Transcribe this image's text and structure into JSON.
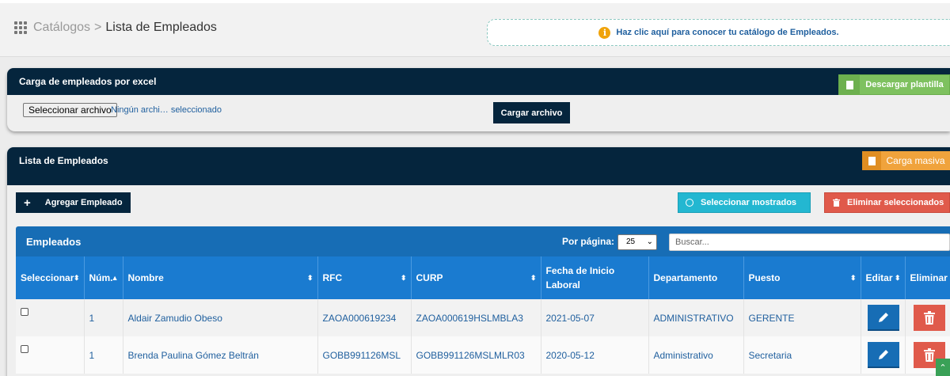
{
  "breadcrumb": {
    "parent": "Catálogos",
    "separator": ">",
    "current": "Lista de Empleados"
  },
  "info_banner": {
    "icon": "info-icon",
    "text": "Haz clic aquí para conocer tu catálogo de Empleados."
  },
  "excel_card": {
    "title": "Carga de empleados por excel",
    "download_label": "Descargar plantilla",
    "file_button": "Seleccionar archivo",
    "file_status": "Ningún archi… seleccionado",
    "upload_label": "Cargar archivo"
  },
  "list_card": {
    "title": "Lista de Empleados",
    "bulk_label": "Carga masiva",
    "add_label": "Agregar Empleado",
    "add_icon": "+",
    "select_shown_label": "Seleccionar mostrados",
    "delete_selected_label": "Eliminar seleccionados"
  },
  "table": {
    "title": "Empleados",
    "per_page_label": "Por página:",
    "per_page_value": "25",
    "search_placeholder": "Buscar...",
    "columns": [
      "Seleccionar",
      "Núm.",
      "Nombre",
      "RFC",
      "CURP",
      "Fecha de Inicio Laboral",
      "Departamento",
      "Puesto",
      "Editar",
      "Eliminar"
    ],
    "rows": [
      {
        "num": "1",
        "nombre": "Aldair Zamudio Obeso",
        "rfc": "ZAOA000619234",
        "curp": "ZAOA000619HSLMBLA3",
        "fecha": "2021-05-07",
        "departamento": "ADMINISTRATIVO",
        "puesto": "GERENTE"
      },
      {
        "num": "1",
        "nombre": "Brenda Paulina Gómez Beltrán",
        "rfc": "GOBB991126MSL",
        "curp": "GOBB991126MSLMLR03",
        "fecha": "2020-05-12",
        "departamento": "Administrativo",
        "puesto": "Secretaria"
      }
    ]
  },
  "colors": {
    "navy": "#05253d",
    "blue": "#176db5",
    "green": "#7ec15f",
    "orange": "#f0a33c",
    "cyan": "#23b7d1",
    "red": "#e05a4b"
  }
}
